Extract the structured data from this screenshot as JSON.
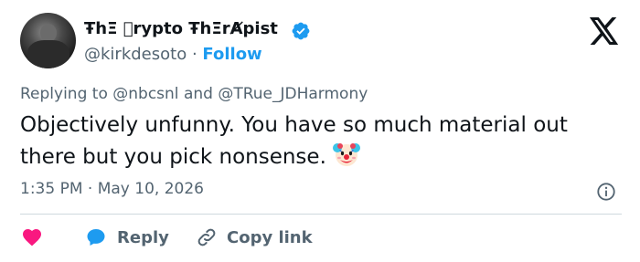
{
  "user": {
    "display_name": "ŦhΞ ⃠rypto ŦhΞrȺpist",
    "handle": "@kirkdesoto",
    "separator": "·",
    "follow_label": "Follow",
    "verified": true
  },
  "brand": {
    "logo": "x-logo-icon"
  },
  "tweet": {
    "replying_prefix": "Replying to",
    "mention_1": "@nbcsnl",
    "replying_and": "and",
    "mention_2": "@TRue_JDHarmony",
    "text": "Objectively unfunny. You have so much material out there but you pick nonsense.",
    "emoji": "clown-face-icon",
    "time": "1:35 PM",
    "date_separator": "·",
    "date": "May 10, 2026"
  },
  "actions": {
    "like_icon": "heart-icon",
    "reply_icon": "speech-bubble-icon",
    "reply_label": "Reply",
    "copy_icon": "link-icon",
    "copy_label": "Copy link"
  },
  "colors": {
    "accent": "#1d9bf0",
    "like": "#f91880",
    "secondary_text": "#536471",
    "primary_text": "#0f1419",
    "divider": "#cfd9de"
  }
}
